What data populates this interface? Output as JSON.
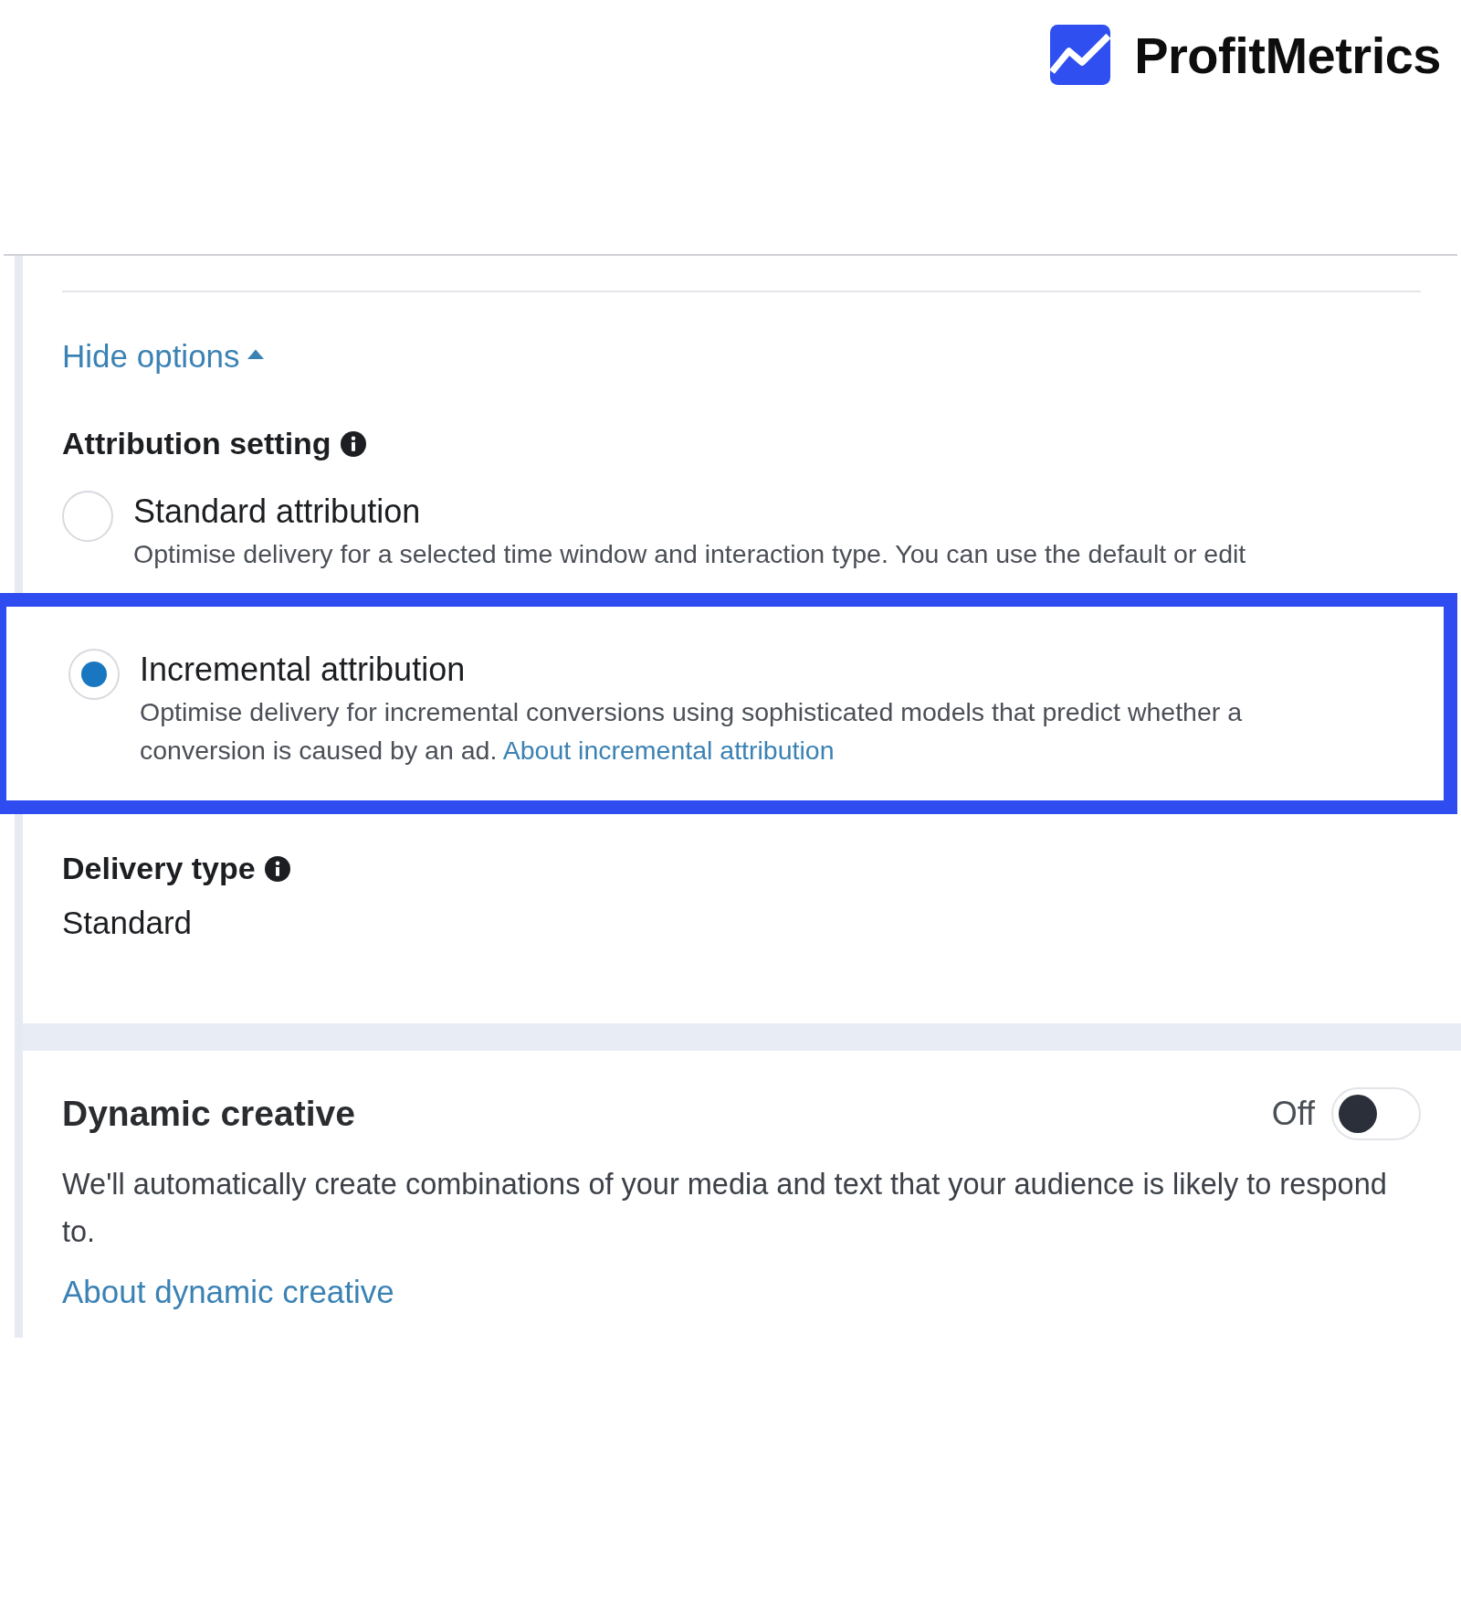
{
  "logo": {
    "text": "ProfitMetrics"
  },
  "hide_options": {
    "label": "Hide options",
    "expanded": true
  },
  "attribution": {
    "title": "Attribution setting",
    "options": [
      {
        "label": "Standard attribution",
        "description": "Optimise delivery for a selected time window and interaction type. You can use the default or edit",
        "selected": false,
        "highlighted": false
      },
      {
        "label": "Incremental attribution",
        "description": "Optimise delivery for incremental conversions using sophisticated models that predict whether a conversion is caused by an ad.",
        "link": "About incremental attribution",
        "selected": true,
        "highlighted": true
      }
    ]
  },
  "delivery_type": {
    "title": "Delivery type",
    "value": "Standard"
  },
  "dynamic_creative": {
    "title": "Dynamic creative",
    "toggle": {
      "label": "Off",
      "on": false
    },
    "description": "We'll automatically create combinations of your media and text that your audience is likely to respond to.",
    "link": "About dynamic creative"
  }
}
